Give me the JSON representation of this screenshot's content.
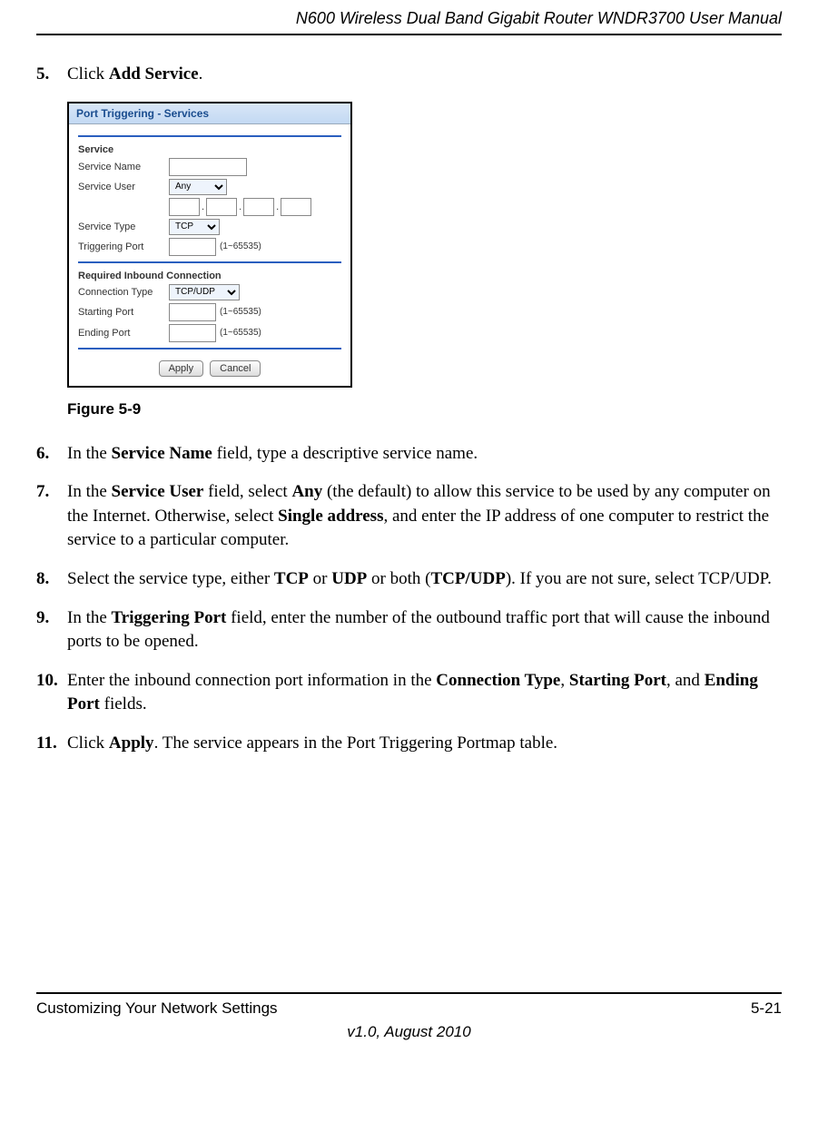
{
  "header": {
    "title": "N600 Wireless Dual Band Gigabit Router WNDR3700 User Manual"
  },
  "steps": {
    "s5": {
      "num": "5.",
      "text_pre": "Click ",
      "bold1": "Add Service",
      "text_post": "."
    },
    "s6": {
      "num": "6.",
      "text_pre": "In the ",
      "bold1": "Service Name",
      "text_post": " field, type a descriptive service name."
    },
    "s7": {
      "num": "7.",
      "p1": "In the ",
      "b1": "Service User",
      "p2": " field, select ",
      "b2": "Any",
      "p3": " (the default) to allow this service to be used by any computer on the Internet. Otherwise, select ",
      "b3": "Single address",
      "p4": ", and enter the IP address of one computer to restrict the service to a particular computer."
    },
    "s8": {
      "num": "8.",
      "p1": "Select the service type, either ",
      "b1": "TCP",
      "p2": " or ",
      "b2": "UDP",
      "p3": " or both (",
      "b3": "TCP/UDP",
      "p4": "). If you are not sure, select TCP/UDP."
    },
    "s9": {
      "num": "9.",
      "p1": "In the ",
      "b1": "Triggering Port",
      "p2": " field, enter the number of the outbound traffic port that will cause the inbound ports to be opened."
    },
    "s10": {
      "num": "10.",
      "p1": "Enter the inbound connection port information in the ",
      "b1": "Connection Type",
      "p2": ", ",
      "b2": "Starting Port",
      "p3": ", and ",
      "b3": "Ending Port",
      "p4": " fields."
    },
    "s11": {
      "num": "11.",
      "p1": "Click ",
      "b1": "Apply",
      "p2": ". The service appears in the Port Triggering Portmap table."
    }
  },
  "figure": {
    "caption": "Figure 5-9",
    "title": "Port Triggering - Services",
    "section1": "Service",
    "service_name_label": "Service Name",
    "service_user_label": "Service User",
    "service_user_value": "Any",
    "service_type_label": "Service Type",
    "service_type_value": "TCP",
    "triggering_port_label": "Triggering Port",
    "port_hint": "(1~65535)",
    "section2": "Required Inbound Connection",
    "connection_type_label": "Connection Type",
    "connection_type_value": "TCP/UDP",
    "starting_port_label": "Starting Port",
    "ending_port_label": "Ending Port",
    "btn_apply": "Apply",
    "btn_cancel": "Cancel"
  },
  "footer": {
    "left": "Customizing Your Network Settings",
    "right": "5-21",
    "version": "v1.0, August 2010"
  }
}
